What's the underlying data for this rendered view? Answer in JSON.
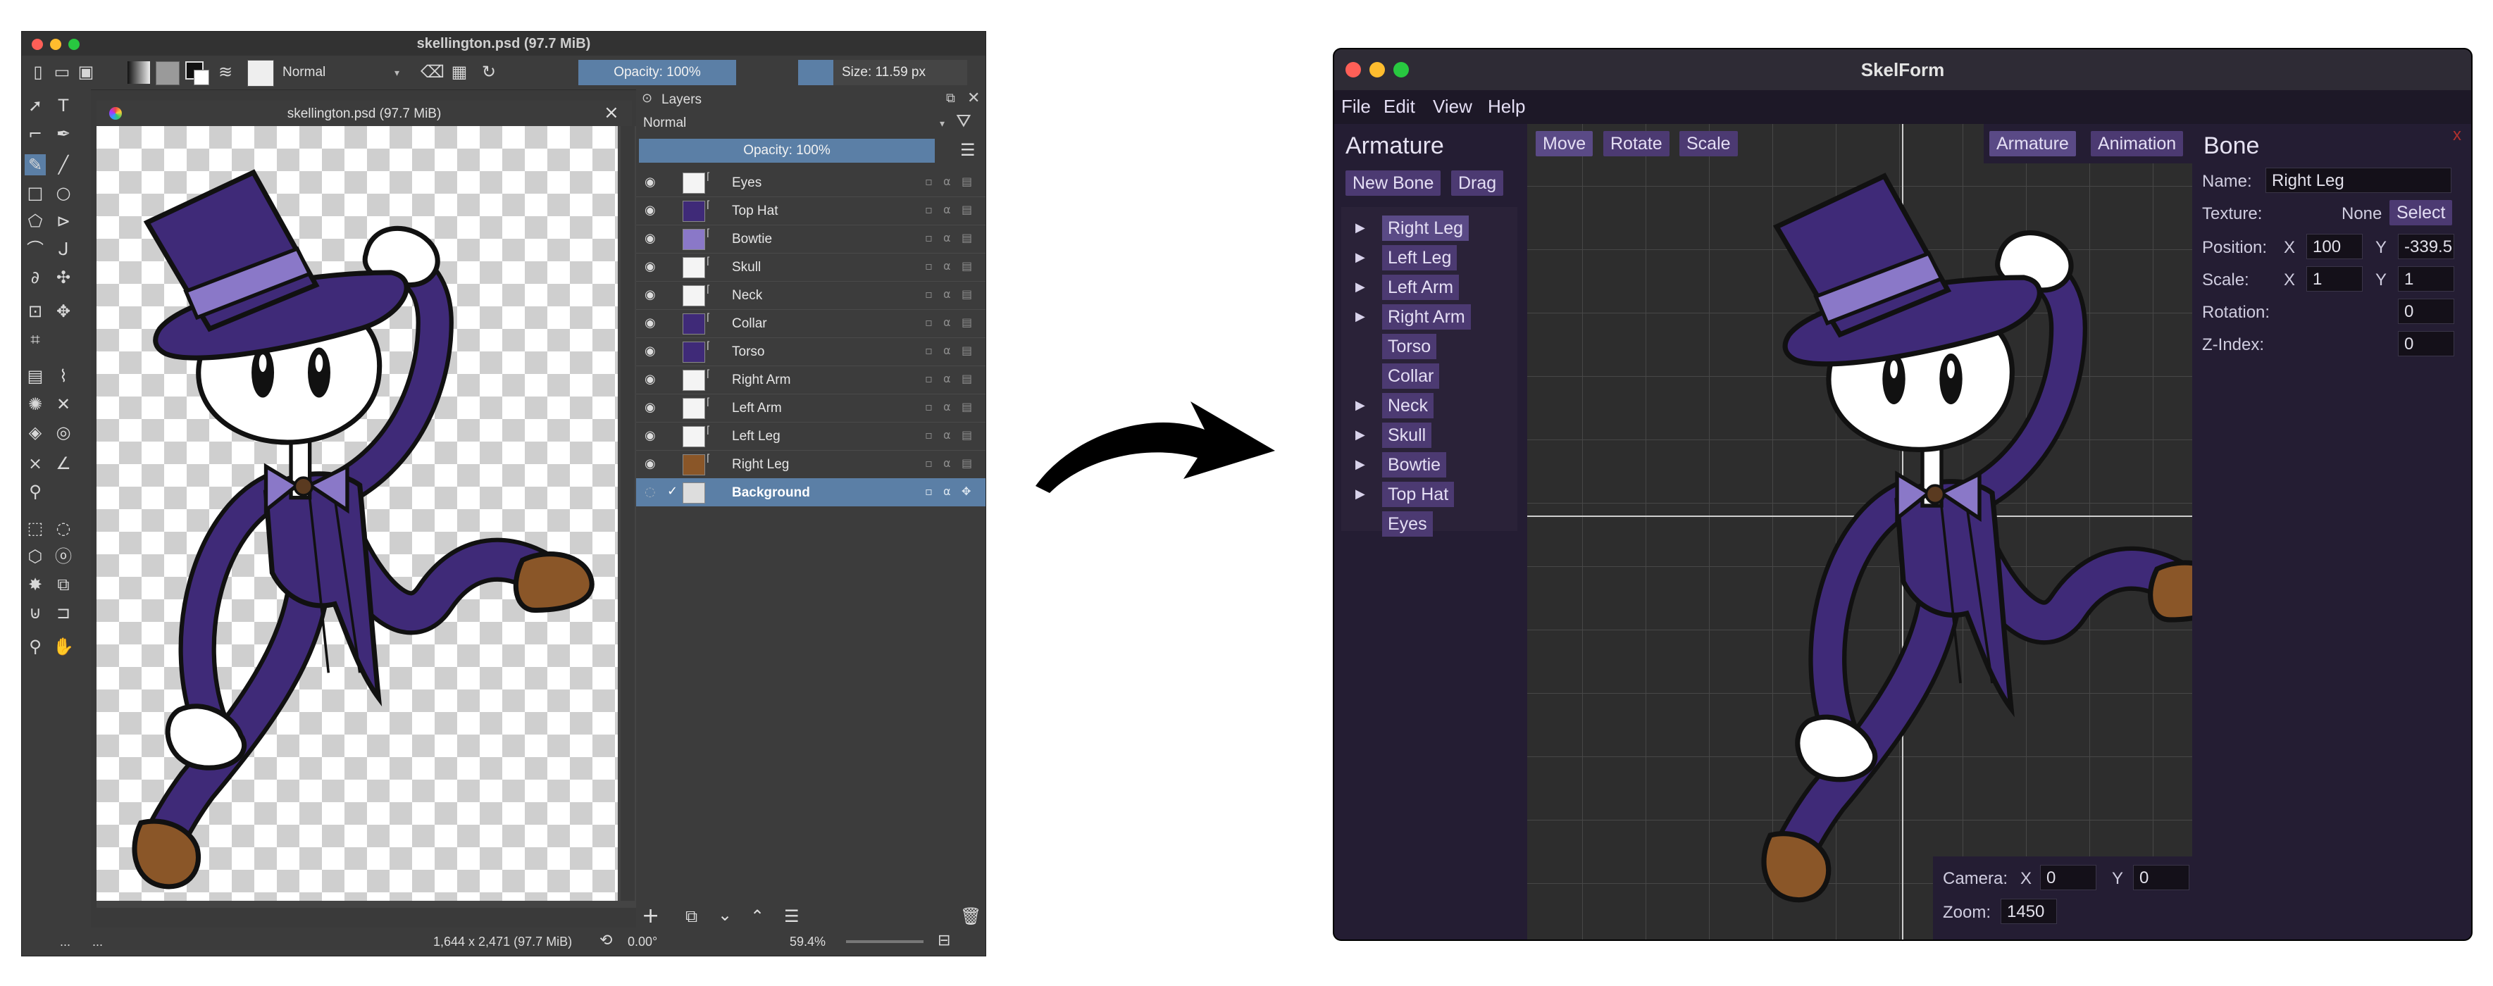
{
  "krita": {
    "title": "skellington.psd (97.7 MiB)",
    "tab_title": "skellington.psd (97.7 MiB)",
    "blend_mode": "Normal",
    "opacity_label": "Opacity: 100%",
    "size_label": "Size: 11.59 px",
    "layers_panel": {
      "title": "Layers",
      "blend_mode": "Normal",
      "opacity_label": "Opacity:  100%",
      "layers": [
        {
          "name": "Eyes"
        },
        {
          "name": "Top Hat"
        },
        {
          "name": "Bowtie"
        },
        {
          "name": "Skull"
        },
        {
          "name": "Neck"
        },
        {
          "name": "Collar"
        },
        {
          "name": "Torso"
        },
        {
          "name": "Right Arm"
        },
        {
          "name": "Left Arm"
        },
        {
          "name": "Left Leg"
        },
        {
          "name": "Right Leg"
        },
        {
          "name": "Background"
        }
      ]
    },
    "status": {
      "ellipsis1": "...",
      "ellipsis2": "...",
      "dimensions": "1,644 x 2,471 (97.7 MiB)",
      "rotation": "0.00°",
      "zoom": "59.4%"
    },
    "colors": {
      "accent": "#5b7fa6",
      "panel": "#3c3c3c",
      "dark": "#2b2b2b"
    }
  },
  "skelform": {
    "title": "SkelForm",
    "menu": [
      "File",
      "Edit",
      "View",
      "Help"
    ],
    "armature_panel": {
      "title": "Armature",
      "new_bone": "New Bone",
      "drag": "Drag",
      "bones": [
        {
          "name": "Right Leg",
          "arrow": true
        },
        {
          "name": "Left Leg",
          "arrow": true
        },
        {
          "name": "Left Arm",
          "arrow": true
        },
        {
          "name": "Right Arm",
          "arrow": true
        },
        {
          "name": "Torso",
          "arrow": false
        },
        {
          "name": "Collar",
          "arrow": false
        },
        {
          "name": "Neck",
          "arrow": true
        },
        {
          "name": "Skull",
          "arrow": true
        },
        {
          "name": "Bowtie",
          "arrow": true
        },
        {
          "name": "Top Hat",
          "arrow": true
        },
        {
          "name": "Eyes",
          "arrow": false
        }
      ]
    },
    "toolbar": {
      "move": "Move",
      "rotate": "Rotate",
      "scale": "Scale",
      "armature": "Armature",
      "animation": "Animation"
    },
    "bone_panel": {
      "title": "Bone",
      "close": "x",
      "name_label": "Name:",
      "name_value": "Right Leg",
      "texture_label": "Texture:",
      "texture_value": "None",
      "select": "Select",
      "position_label": "Position:",
      "x": "X",
      "y": "Y",
      "pos_x": "100",
      "pos_y": "-339.5",
      "scale_label": "Scale:",
      "scale_x": "1",
      "scale_y": "1",
      "rotation_label": "Rotation:",
      "rotation_value": "0",
      "zindex_label": "Z-Index:",
      "zindex_value": "0"
    },
    "camera": {
      "label": "Camera:",
      "x": "X",
      "y": "Y",
      "x_value": "0",
      "y_value": "0",
      "zoom_label": "Zoom:",
      "zoom_value": "1450"
    },
    "colors": {
      "bg": "#1a1522",
      "panel": "#241d33",
      "button": "#4c3a72",
      "viewport": "#2d2d2d"
    }
  },
  "character_colors": {
    "purple": "#3f2a78",
    "band": "#8a78c8",
    "shoe": "#8a5628",
    "outline": "#111111"
  }
}
